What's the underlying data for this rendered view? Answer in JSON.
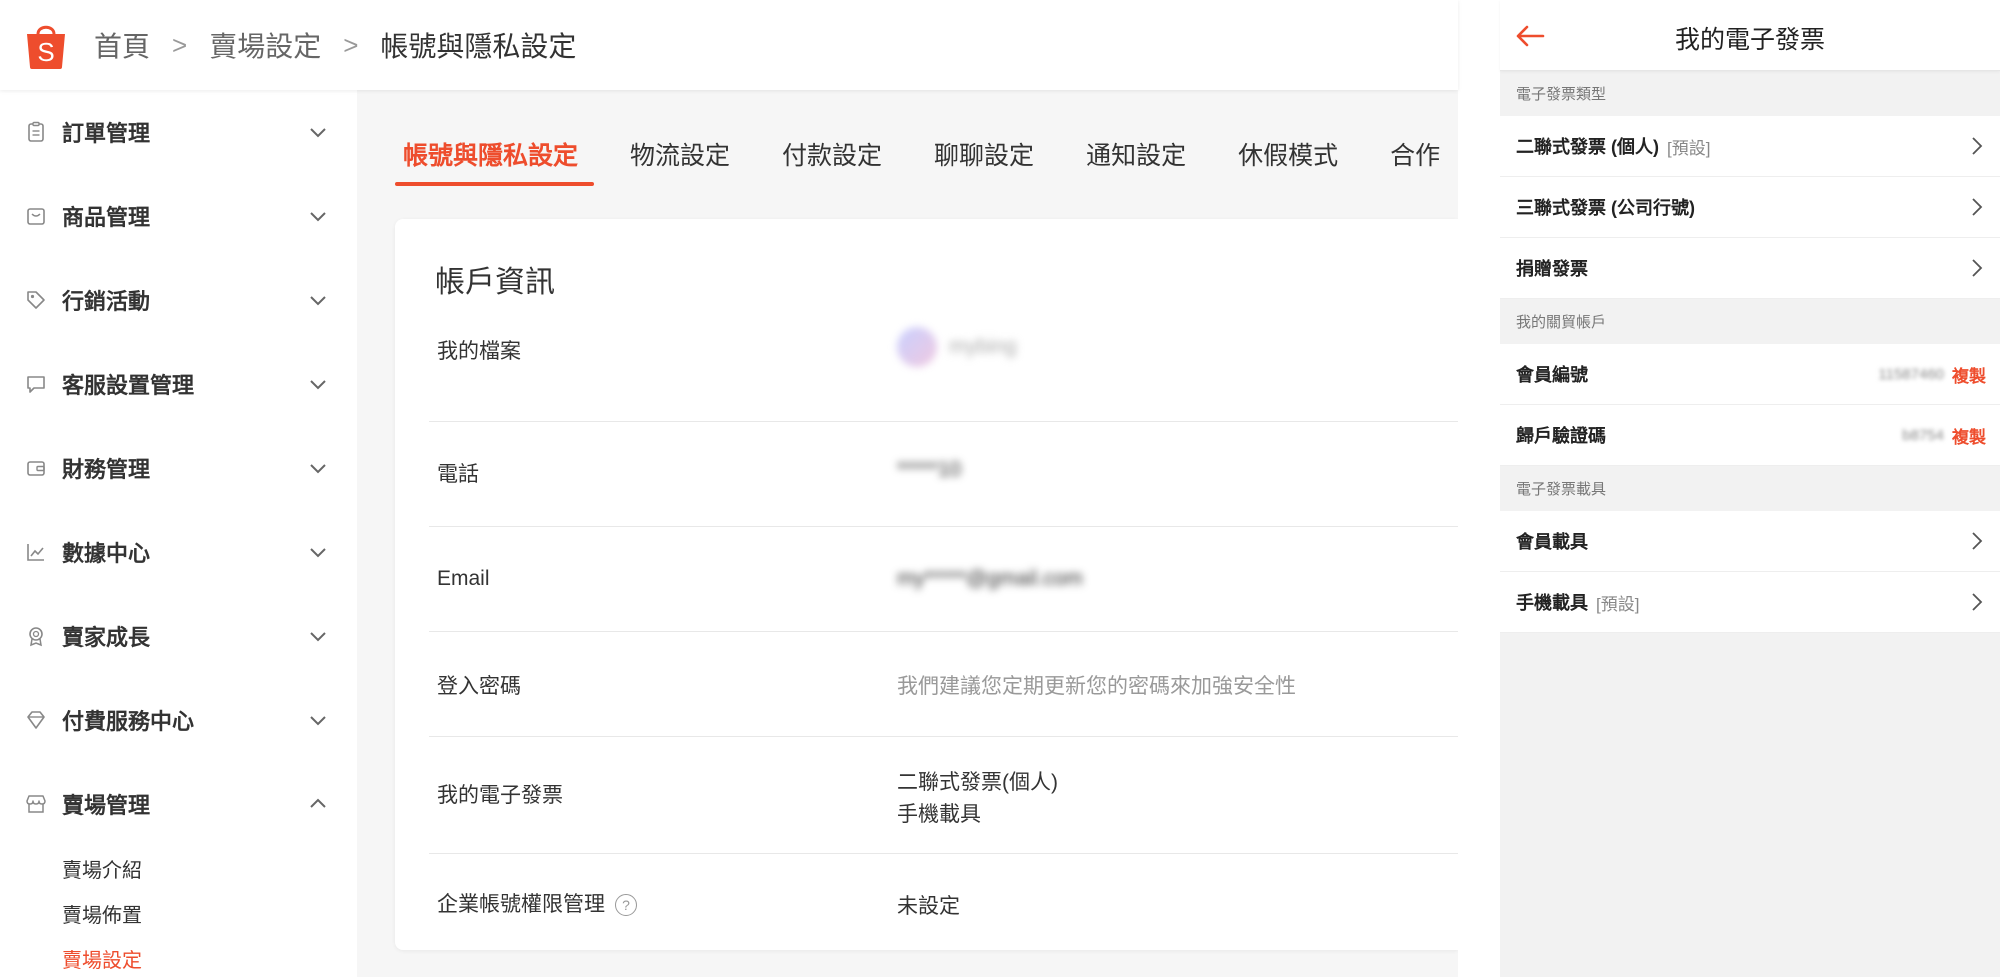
{
  "header": {
    "breadcrumbs": [
      "首頁",
      "賣場設定",
      "帳號與隱私設定"
    ],
    "separator": ">"
  },
  "sidebar": {
    "items": [
      {
        "label": "訂單管理",
        "icon": "clipboard-icon"
      },
      {
        "label": "商品管理",
        "icon": "bag-icon"
      },
      {
        "label": "行銷活動",
        "icon": "tag-icon"
      },
      {
        "label": "客服設置管理",
        "icon": "chat-icon"
      },
      {
        "label": "財務管理",
        "icon": "wallet-icon"
      },
      {
        "label": "數據中心",
        "icon": "chart-icon"
      },
      {
        "label": "賣家成長",
        "icon": "badge-icon"
      },
      {
        "label": "付費服務中心",
        "icon": "diamond-icon"
      },
      {
        "label": "賣場管理",
        "icon": "store-icon"
      }
    ],
    "sub_items": [
      {
        "label": "賣場介紹"
      },
      {
        "label": "賣場佈置"
      },
      {
        "label": "賣場設定"
      }
    ]
  },
  "tabs": [
    "帳號與隱私設定",
    "物流設定",
    "付款設定",
    "聊聊設定",
    "通知設定",
    "休假模式",
    "合作"
  ],
  "card": {
    "title": "帳戶資訊",
    "rows": [
      {
        "key": "我的檔案",
        "value": "mybing"
      },
      {
        "key": "電話",
        "value": "*****10"
      },
      {
        "key": "Email",
        "value": "my*****@gmail.com"
      },
      {
        "key": "登入密碼",
        "value": "我們建議您定期更新您的密碼來加強安全性"
      },
      {
        "key": "我的電子發票",
        "value_line1": "二聯式發票(個人)",
        "value_line2": "手機載具"
      },
      {
        "key": "企業帳號權限管理",
        "value": "未設定"
      }
    ]
  },
  "panel": {
    "title": "我的電子發票",
    "section1": "電子發票類型",
    "invoice_types": [
      {
        "label": "二聯式發票 (個人)",
        "tag": "[預設]"
      },
      {
        "label": "三聯式發票 (公司行號)",
        "tag": ""
      },
      {
        "label": "捐贈發票",
        "tag": ""
      }
    ],
    "section2": "我的關貿帳戶",
    "accounts": [
      {
        "label": "會員編號",
        "value": "11587460",
        "action": "複製"
      },
      {
        "label": "歸戶驗證碼",
        "value": "b8754",
        "action": "複製"
      }
    ],
    "section3": "電子發票載具",
    "carriers": [
      {
        "label": "會員載具",
        "tag": ""
      },
      {
        "label": "手機載具",
        "tag": "[預設]"
      }
    ]
  },
  "colors": {
    "accent": "#ee4d2d",
    "text": "#333333",
    "muted": "#999999",
    "background": "#f6f6f6"
  }
}
